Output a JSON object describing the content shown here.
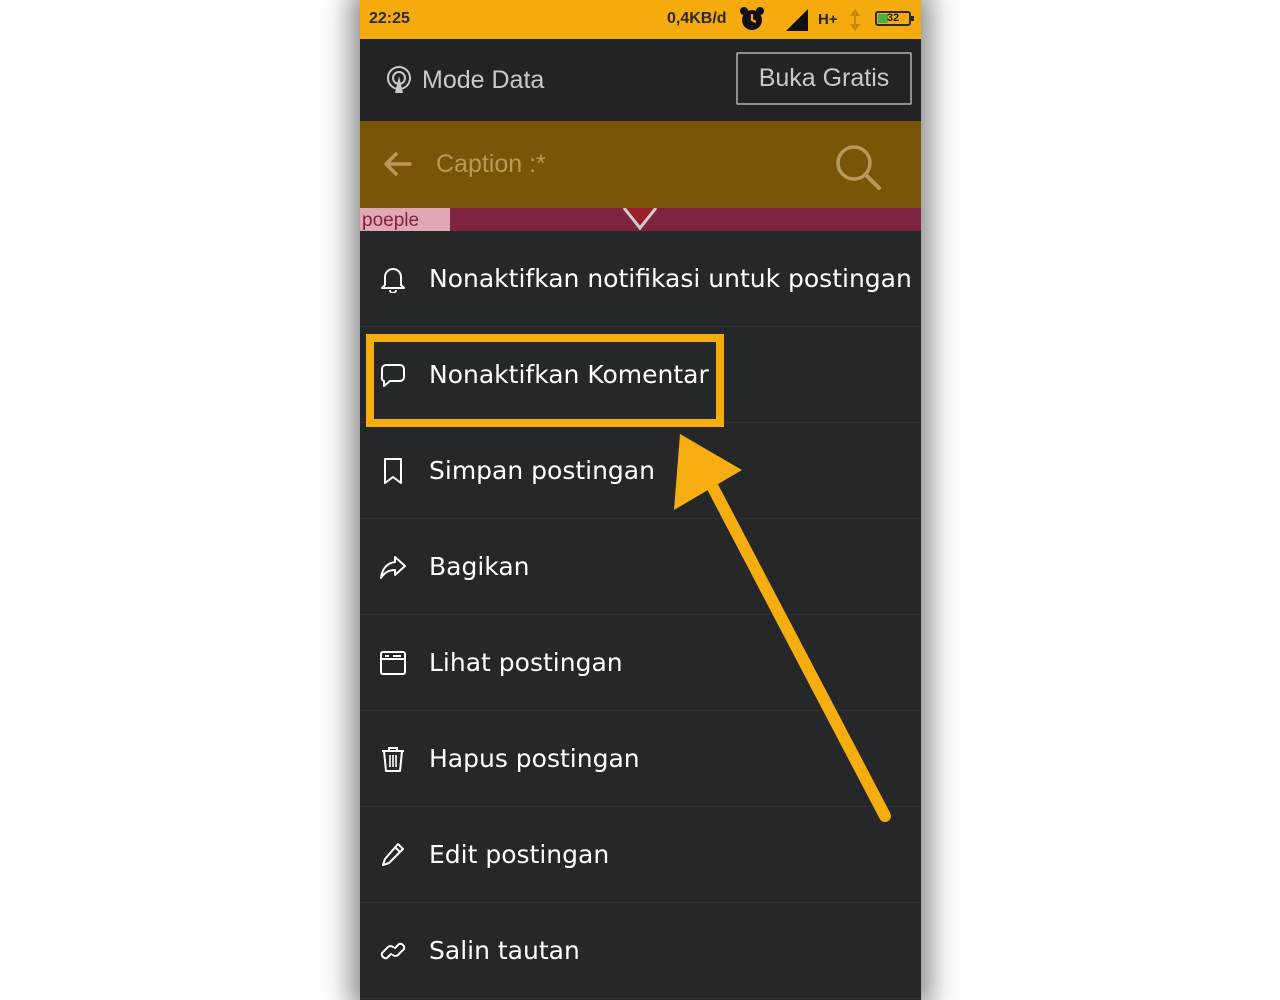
{
  "status_bar": {
    "time": "22:25",
    "net_speed": "0,4KB/d",
    "network_type": "H+",
    "battery_level": "32",
    "battery_fraction": 0.32,
    "icons": [
      "alarm-clock-icon",
      "signal-icon",
      "data-arrows-icon",
      "battery-icon"
    ],
    "background_color": "#f5ab0d"
  },
  "mode_bar": {
    "label": "Mode Data",
    "button_label": "Buka Gratis",
    "icon": "data-mode-icon"
  },
  "app_bar": {
    "title": "Caption :*",
    "icons": [
      "back-arrow-icon",
      "search-icon"
    ],
    "background_color": "#7b5507"
  },
  "post_peek": {
    "text": "poeple"
  },
  "menu": {
    "items": [
      {
        "label": "Nonaktifkan notifikasi untuk postingan ini",
        "icon": "bell-icon"
      },
      {
        "label": "Nonaktifkan Komentar",
        "icon": "comment-icon"
      },
      {
        "label": "Simpan postingan",
        "icon": "bookmark-icon"
      },
      {
        "label": "Bagikan",
        "icon": "share-icon"
      },
      {
        "label": "Lihat postingan",
        "icon": "view-post-icon"
      },
      {
        "label": "Hapus postingan",
        "icon": "trash-icon"
      },
      {
        "label": "Edit postingan",
        "icon": "pencil-icon"
      },
      {
        "label": "Salin tautan",
        "icon": "link-icon"
      }
    ],
    "background_color": "#262729"
  },
  "annotation": {
    "highlighted_item": "Nonaktifkan Komentar",
    "color": "#f5ad0f"
  }
}
